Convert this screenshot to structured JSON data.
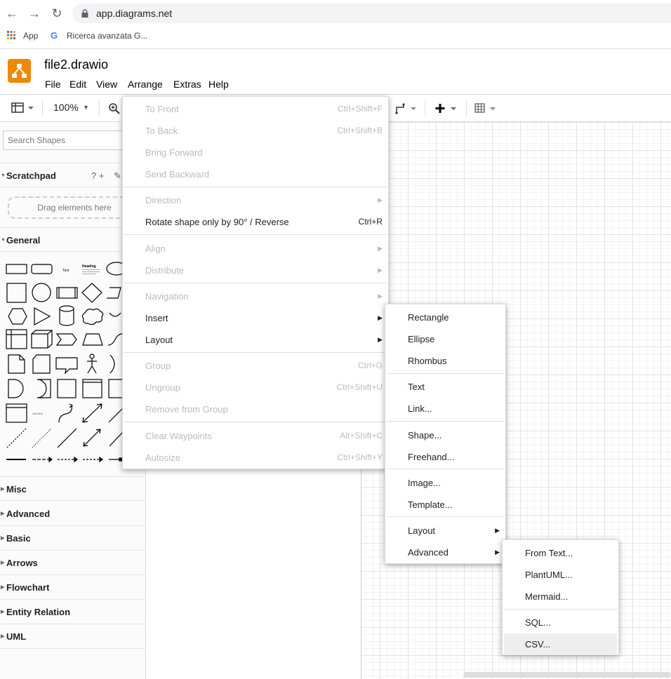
{
  "browser": {
    "url": "app.diagrams.net",
    "bookmarks": [
      "App",
      "Ricerca avanzata G..."
    ]
  },
  "app": {
    "filename": "file2.drawio",
    "menus": [
      "File",
      "Edit",
      "View",
      "Arrange",
      "Extras",
      "Help"
    ]
  },
  "toolbar": {
    "zoom": "100%"
  },
  "sidebar": {
    "search_placeholder": "Search Shapes",
    "scratchpad": "Scratchpad",
    "scratchpad_tools": "? +",
    "drag_hint": "Drag elements here",
    "general": "General",
    "sections": [
      "Misc",
      "Advanced",
      "Basic",
      "Arrows",
      "Flowchart",
      "Entity Relation",
      "UML"
    ],
    "shape_text_label": "Text",
    "shape_heading_label": "Heading",
    "shape_list_label": "List Item"
  },
  "arrange_menu": {
    "items": [
      {
        "label": "To Front",
        "shortcut": "Ctrl+Shift+F",
        "disabled": true
      },
      {
        "label": "To Back",
        "shortcut": "Ctrl+Shift+B",
        "disabled": true
      },
      {
        "label": "Bring Forward",
        "shortcut": "",
        "disabled": true
      },
      {
        "label": "Send Backward",
        "shortcut": "",
        "disabled": true
      },
      {
        "label": "Direction",
        "shortcut": "",
        "disabled": true,
        "submenu": true
      },
      {
        "label": "Rotate shape only by 90° / Reverse",
        "shortcut": "Ctrl+R",
        "disabled": false
      },
      {
        "label": "Align",
        "shortcut": "",
        "disabled": true,
        "submenu": true
      },
      {
        "label": "Distribute",
        "shortcut": "",
        "disabled": true,
        "submenu": true
      },
      {
        "label": "Navigation",
        "shortcut": "",
        "disabled": true,
        "submenu": true
      },
      {
        "label": "Insert",
        "shortcut": "",
        "disabled": false,
        "submenu": true
      },
      {
        "label": "Layout",
        "shortcut": "",
        "disabled": false,
        "submenu": true
      },
      {
        "label": "Group",
        "shortcut": "Ctrl+G",
        "disabled": true
      },
      {
        "label": "Ungroup",
        "shortcut": "Ctrl+Shift+U",
        "disabled": true
      },
      {
        "label": "Remove from Group",
        "shortcut": "",
        "disabled": true
      },
      {
        "label": "Clear Waypoints",
        "shortcut": "Alt+Shift+C",
        "disabled": true
      },
      {
        "label": "Autosize",
        "shortcut": "Ctrl+Shift+Y",
        "disabled": true
      }
    ]
  },
  "insert_menu": {
    "items": [
      {
        "label": "Rectangle"
      },
      {
        "label": "Ellipse"
      },
      {
        "label": "Rhombus"
      },
      {
        "label": "Text"
      },
      {
        "label": "Link..."
      },
      {
        "label": "Shape..."
      },
      {
        "label": "Freehand..."
      },
      {
        "label": "Image..."
      },
      {
        "label": "Template..."
      },
      {
        "label": "Layout",
        "submenu": true
      },
      {
        "label": "Advanced",
        "submenu": true
      }
    ]
  },
  "advanced_menu": {
    "items": [
      {
        "label": "From Text..."
      },
      {
        "label": "PlantUML..."
      },
      {
        "label": "Mermaid..."
      },
      {
        "label": "SQL..."
      },
      {
        "label": "CSV...",
        "highlighted": true
      }
    ]
  }
}
